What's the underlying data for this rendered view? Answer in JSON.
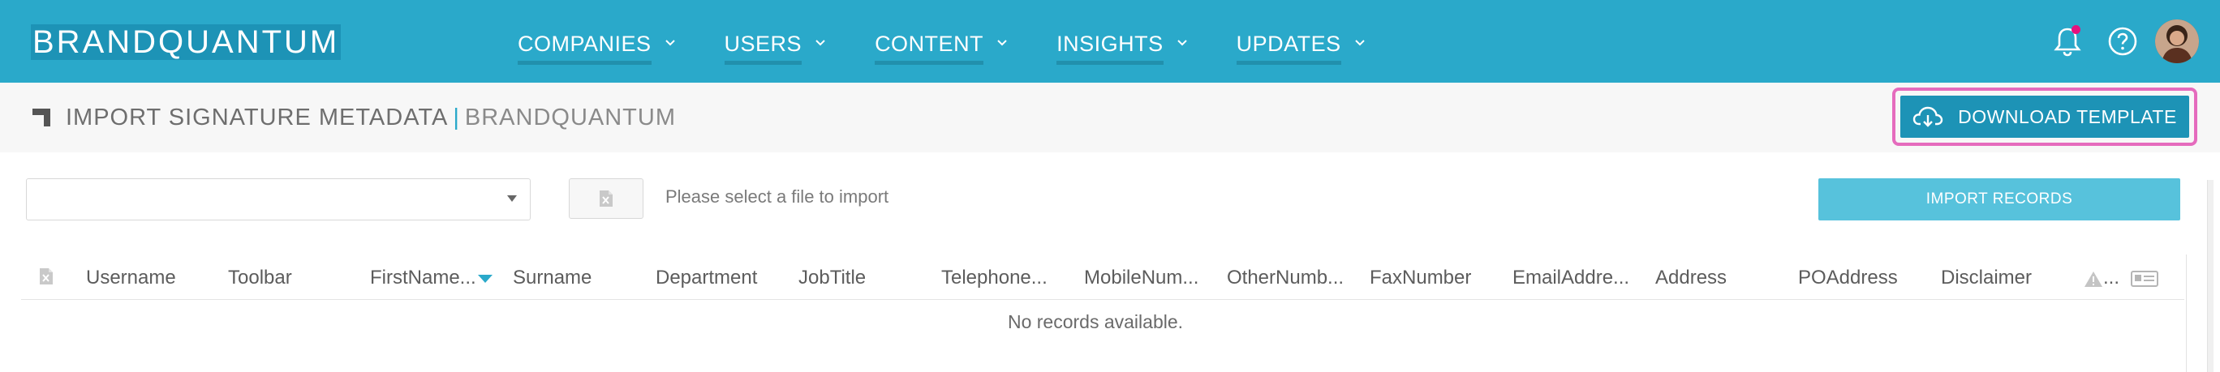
{
  "brand": {
    "logo_text": "BRANDQUANTUM",
    "accent": "#2aa9ca",
    "nav_bg": "#2aa9ca",
    "highlight_outline": "#e56bbd",
    "notification_dot": "#e6117d"
  },
  "nav": {
    "items": [
      {
        "label": "COMPANIES",
        "icon": "chevron-down-icon"
      },
      {
        "label": "USERS",
        "icon": "chevron-down-icon"
      },
      {
        "label": "CONTENT",
        "icon": "chevron-down-icon"
      },
      {
        "label": "INSIGHTS",
        "icon": "chevron-down-icon"
      },
      {
        "label": "UPDATES",
        "icon": "chevron-down-icon"
      }
    ],
    "right_icons": [
      "bell-icon",
      "help-icon",
      "avatar"
    ]
  },
  "header": {
    "title": "IMPORT SIGNATURE METADATA",
    "separator": "|",
    "org": "BRANDQUANTUM",
    "download_label": "DOWNLOAD TEMPLATE",
    "download_icon": "cloud-download-icon"
  },
  "import": {
    "select_value": "",
    "file_hint": "Please select a file to import",
    "import_label": "IMPORT RECORDS",
    "file_icon": "excel-file-icon"
  },
  "grid": {
    "columns": [
      "Username",
      "Toolbar",
      "FirstName...",
      "Surname",
      "Department",
      "JobTitle",
      "Telephone...",
      "MobileNum...",
      "OtherNumb...",
      "FaxNumber",
      "EmailAddre...",
      "Address",
      "POAddress",
      "Disclaimer",
      "..."
    ],
    "sorted_column": "FirstName...",
    "sort_direction": "descending",
    "empty_message": "No records available."
  }
}
